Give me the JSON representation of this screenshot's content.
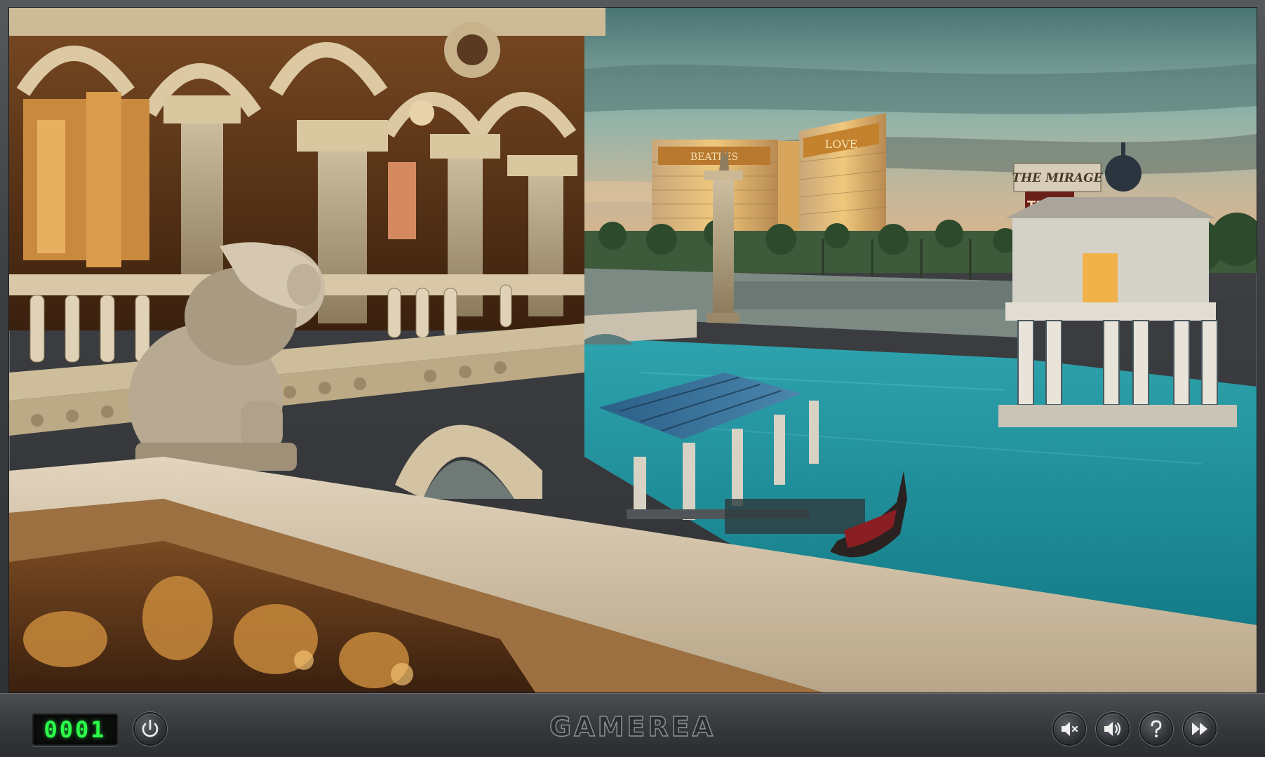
{
  "game": {
    "brand": "GAMEREA",
    "counter": "0001",
    "scene": {
      "sign_mirage": "THE MIRAGE",
      "sign_terry": "TERRY",
      "sign_beatles": "BEATLES",
      "sign_love": "LOVE"
    }
  },
  "controls": {
    "power": "power-icon",
    "mute": "mute-icon",
    "volume": "volume-icon",
    "help": "help-icon",
    "skip": "fast-forward-icon"
  },
  "colors": {
    "counter_green": "#2cff48",
    "water": "#1f8f9a",
    "sky": "#6f9f98"
  }
}
